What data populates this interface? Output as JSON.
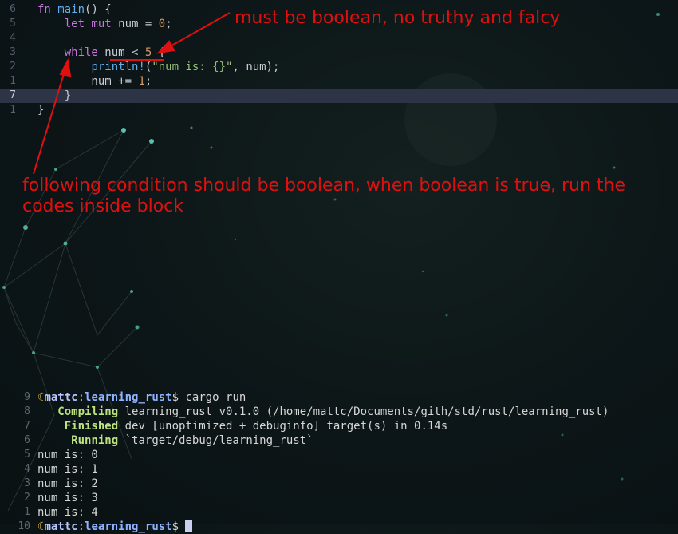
{
  "editor": {
    "lines": [
      {
        "num": "6",
        "tokens": [
          [
            "kw",
            "fn"
          ],
          [
            "pl",
            " "
          ],
          [
            "fn",
            "main"
          ],
          [
            "pl",
            "() {"
          ]
        ]
      },
      {
        "num": "5",
        "tokens": [
          [
            "pl",
            "    "
          ],
          [
            "kw",
            "let mut"
          ],
          [
            "pl",
            " num = "
          ],
          [
            "num",
            "0"
          ],
          [
            "pl",
            ";"
          ]
        ]
      },
      {
        "num": "4",
        "tokens": []
      },
      {
        "num": "3",
        "tokens": [
          [
            "pl",
            "    "
          ],
          [
            "kw",
            "while"
          ],
          [
            "pl",
            " num < "
          ],
          [
            "num",
            "5"
          ],
          [
            "pl",
            " {"
          ]
        ]
      },
      {
        "num": "2",
        "tokens": [
          [
            "pl",
            "        "
          ],
          [
            "mac",
            "println!"
          ],
          [
            "pl",
            "("
          ],
          [
            "str",
            "\"num is: {}\""
          ],
          [
            "pl",
            ", num);"
          ]
        ]
      },
      {
        "num": "1",
        "tokens": [
          [
            "pl",
            "        num += "
          ],
          [
            "num",
            "1"
          ],
          [
            "pl",
            ";"
          ]
        ]
      },
      {
        "num": "7",
        "current": true,
        "tokens": [
          [
            "pl",
            "    }"
          ]
        ]
      },
      {
        "num": "1",
        "tokens": [
          [
            "pl",
            "}"
          ]
        ]
      }
    ]
  },
  "annotations": {
    "boolean_note": "must be boolean, no truthy and falcy",
    "condition_note": "following condition should be boolean, when boolean is true, run the codes inside block",
    "color": "#e01010"
  },
  "terminal": {
    "prompt": {
      "user": "mattc",
      "dir": "learning_rust",
      "command": "$ cargo run"
    },
    "lines": [
      {
        "num": "9",
        "type": "prompt"
      },
      {
        "num": "8",
        "type": "status",
        "status": "Compiling",
        "indent": "   ",
        "text": " learning_rust v0.1.0 (/home/mattc/Documents/gith/std/rust/learning_rust)"
      },
      {
        "num": "7",
        "type": "status",
        "status": "Finished",
        "indent": "    ",
        "text": " dev [unoptimized + debuginfo] target(s) in 0.14s"
      },
      {
        "num": "6",
        "type": "status",
        "status": "Running",
        "indent": "     ",
        "text": " `target/debug/learning_rust`"
      },
      {
        "num": "5",
        "type": "out",
        "text": "num is: 0"
      },
      {
        "num": "4",
        "type": "out",
        "text": "num is: 1"
      },
      {
        "num": "3",
        "type": "out",
        "text": "num is: 2"
      },
      {
        "num": "2",
        "type": "out",
        "text": "num is: 3"
      },
      {
        "num": "1",
        "type": "out",
        "text": "num is: 4"
      },
      {
        "num": "10",
        "type": "prompt-cursor"
      }
    ]
  }
}
